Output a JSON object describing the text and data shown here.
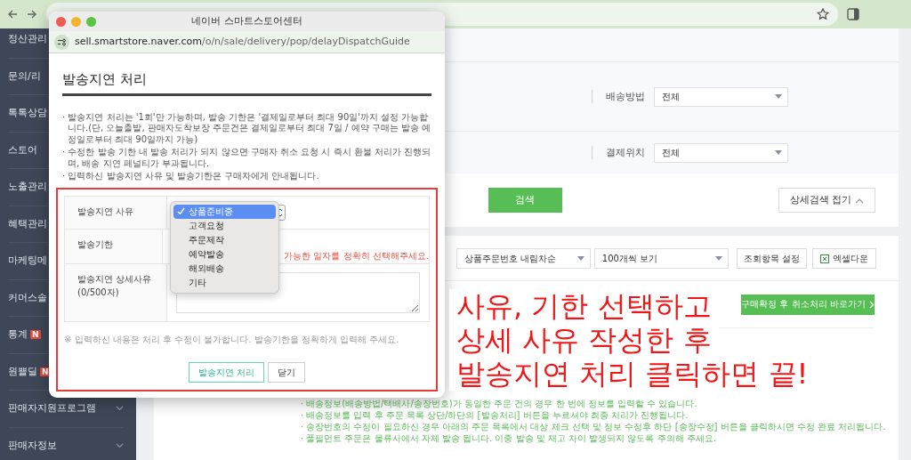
{
  "sidebar": {
    "items": [
      {
        "label": "정산관리",
        "kind": "link"
      },
      {
        "label": "문의/리",
        "kind": "link"
      },
      {
        "label": "톡톡상담",
        "kind": "link"
      },
      {
        "label": "스토어",
        "kind": "link"
      },
      {
        "label": "노출관리",
        "kind": "link"
      },
      {
        "label": "혜택관리",
        "kind": "link"
      },
      {
        "label": "마케팅메",
        "kind": "link"
      },
      {
        "label": "커머스솔",
        "kind": "link"
      },
      {
        "label": "통계",
        "kind": "link",
        "badge": "N"
      },
      {
        "label": "원쁠딜",
        "kind": "link",
        "badge": "N"
      },
      {
        "label": "판매자지원프로그램",
        "kind": "group"
      },
      {
        "label": "판매자정보",
        "kind": "group"
      }
    ]
  },
  "filters": [
    {
      "label": "배송방법",
      "value": "전체"
    },
    {
      "label": "결제위치",
      "value": "전체"
    }
  ],
  "search_button": "검색",
  "collapse_button": "상세검색 접기",
  "toolbar": {
    "selects": [
      "상품주문번호 내림차순",
      "100개씩 보기"
    ],
    "settings_button": "조회항목 설정",
    "excel_button": "엑셀다운"
  },
  "cancel_link_button": "구매확정 후 취소처리 바로가기",
  "notes": [
    "· 배송정보(배송방법/택배사/송장번호)가 동일한 주문 건의 경우 한 번에 정보를 입력할 수 있습니다.",
    "· 배송정보를 입력 후 주문 목록 상단/하단의 [발송처리] 버튼을 누르셔야 최종 처리가 진행됩니다.",
    "· 송장번호의 수정이 필요하신 경우 아래의 주문 목록에서 대상 체크 선택 및 정보 수정후 하단 [송장수정] 버튼을 클릭하시면 수정 완료 처리됩니다.",
    "· 풀필먼트 주문은 물류사에서 자체 발송 됩니다. 이중 발송 및 재고 차이 발생되지 않도록 주의해 주세요."
  ],
  "popup": {
    "title": "네이버 스마트스토어센터",
    "url_domain": "sell.smartstore.naver.com",
    "url_path": "/o/n/sale/delivery/pop/delayDispatchGuide",
    "heading": "발송지연 처리",
    "bullets": [
      "· 발송지연 처리는 '1회'만 가능하며, 발송 기한은 '결제일로부터 최대 90일'까지 설정 가능합니다.(단, 오늘출발, 판매자도착보장 주문건은 결제일로부터 최대 7일 / 예약 구매는 발송 예정일로부터 최대 90일까지 가능)",
      "· 수정한 발송 기한 내 발송 처리가 되지 않으면 구매자 취소 요청 시 즉시 환불 처리가 진행되며, 배송 지연 페널티가 부과됩니다.",
      "· 입력하신 발송지연 사유 및 발송기한은 구매자에게 안내됩니다."
    ],
    "reason_label": "발송지연 사유",
    "reason_options": [
      {
        "label": "상품준비중",
        "selected": true
      },
      {
        "label": "고객요청",
        "selected": false
      },
      {
        "label": "주문제작",
        "selected": false
      },
      {
        "label": "예약발송",
        "selected": false
      },
      {
        "label": "해외배송",
        "selected": false
      },
      {
        "label": "기타",
        "selected": false
      }
    ],
    "deadline_label": "발송기한",
    "deadline_hint": "가능한 일자를 정확히 선택해주세요.",
    "detail_label": "발송지연 상세사유",
    "detail_counter": "(0/500자)",
    "footnote": "※ 입력하신 내용은 처리 후 수정이 불가합니다. 발송기한을 정확하게 입력해 주세요.",
    "buttons": [
      {
        "label": "발송지연 처리",
        "kind": "primary"
      },
      {
        "label": "닫기",
        "kind": "default"
      }
    ]
  },
  "annotation": {
    "lines": [
      "사유, 기한 선택하고",
      "상세 사유 작성한 후",
      "발송지연 처리 클릭하면 끝!"
    ]
  }
}
